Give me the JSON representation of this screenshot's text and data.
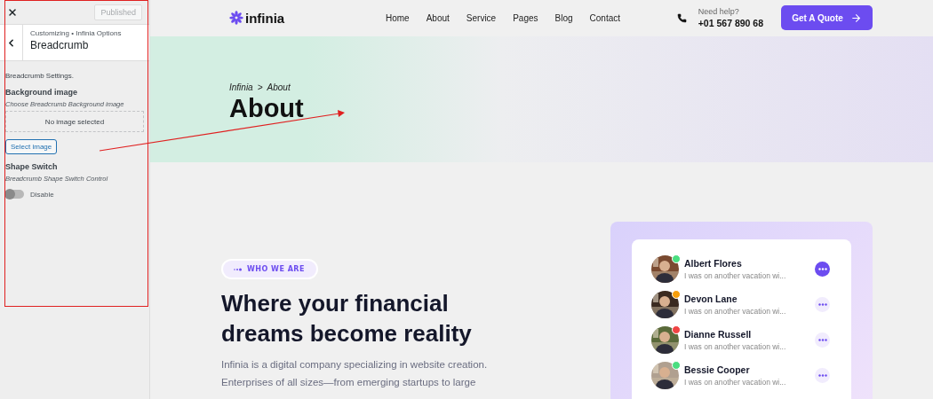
{
  "customizer": {
    "published_button": {
      "label": "Published",
      "disabled": true
    },
    "breadcrumb": "Customizing • Infinia Options",
    "title": "Breadcrumb",
    "intro": "Breadcrumb Settings.",
    "background_image": {
      "label": "Background image",
      "description": "Choose Breadcrumb Background image",
      "placeholder": "No image selected",
      "button": "Select image"
    },
    "shape_switch": {
      "label": "Shape Switch",
      "description": "Breadcrumb Shape Switch Control",
      "on": false,
      "state_label": "Disable"
    }
  },
  "header": {
    "logo": "infinia",
    "nav": [
      "Home",
      "About",
      "Service",
      "Pages",
      "Blog",
      "Contact"
    ],
    "help_label": "Need help?",
    "phone": "+01 567 890 68",
    "cta": "Get A Quote"
  },
  "hero": {
    "breadcrumb_root": "Infinia",
    "breadcrumb_separator": ">",
    "breadcrumb_current": "About",
    "title": "About"
  },
  "about": {
    "badge": "WHO WE ARE",
    "heading": "Where your financial dreams become reality",
    "paragraph": "Infinia is a digital company specializing in website creation. Enterprises of all sizes—from emerging startups to large"
  },
  "contacts": [
    {
      "name": "Albert Flores",
      "message": "I was on another vacation wi...",
      "color": "#4ade80",
      "selected": true
    },
    {
      "name": "Devon Lane",
      "message": "I was on another vacation wi...",
      "color": "#f59e0b",
      "selected": false
    },
    {
      "name": "Dianne Russell",
      "message": "I was on another vacation wi...",
      "color": "#ef4444",
      "selected": false
    },
    {
      "name": "Bessie Cooper",
      "message": "I was on another vacation wi...",
      "color": "#4ade80",
      "selected": false
    }
  ]
}
